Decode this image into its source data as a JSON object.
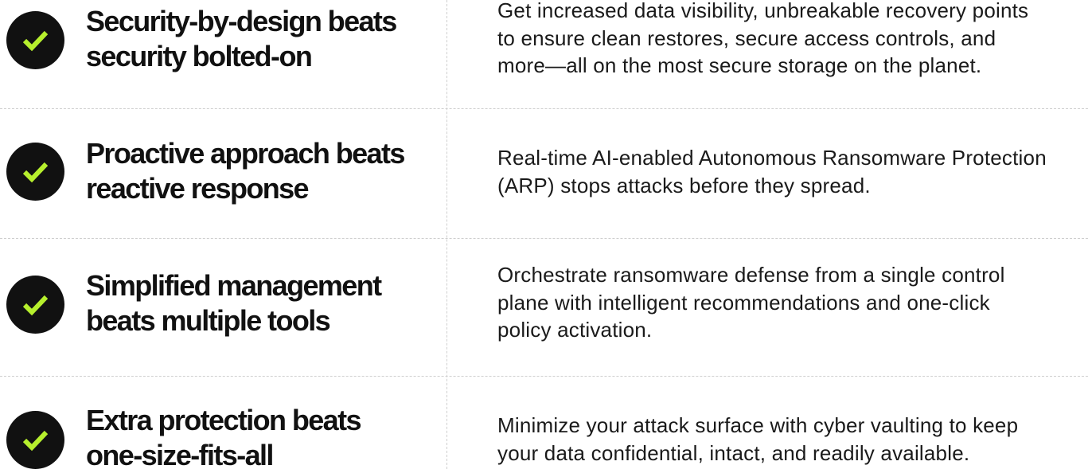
{
  "colors": {
    "check_circle": "#111111",
    "check_mark": "#b6ef2d",
    "divider": "#cfcfcf",
    "heading": "#111111",
    "body_text": "#1a1a1a"
  },
  "rows": [
    {
      "icon": "check-circle-icon",
      "title": "Security-by-design beats\nsecurity bolted-on",
      "description": "Get increased data visibility, unbreakable recovery points\nto ensure clean restores, secure access controls, and\nmore—all on the most secure storage on the planet."
    },
    {
      "icon": "check-circle-icon",
      "title": "Proactive approach beats\nreactive response",
      "description": "Real-time AI-enabled Autonomous Ransomware Protection\n(ARP) stops attacks before they spread."
    },
    {
      "icon": "check-circle-icon",
      "title": "Simplified management\nbeats multiple tools",
      "description": "Orchestrate ransomware defense from a single control\nplane with intelligent recommendations and one-click\npolicy activation."
    },
    {
      "icon": "check-circle-icon",
      "title": "Extra protection beats\none-size-fits-all",
      "description": "Minimize your attack surface with cyber vaulting to keep\nyour data confidential, intact, and readily available."
    }
  ]
}
